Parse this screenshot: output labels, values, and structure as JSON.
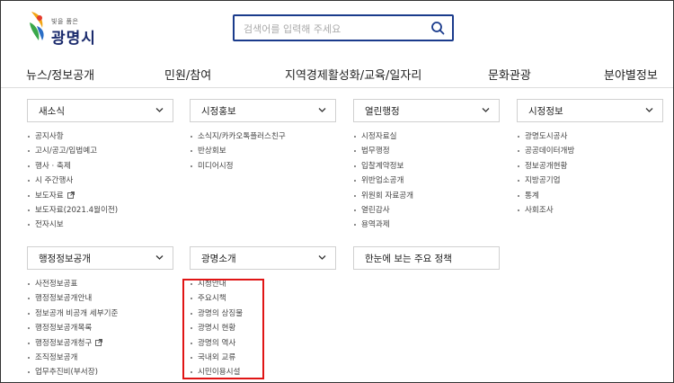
{
  "header": {
    "logo_slogan": "빛을 품은",
    "logo_name": "광명시",
    "search_placeholder": "검색어를 입력해 주세요"
  },
  "nav": [
    "뉴스/정보공개",
    "민원/참여",
    "지역경제활성화/교육/일자리",
    "문화관광",
    "분야별정보"
  ],
  "menus": {
    "news": {
      "title": "새소식",
      "items": [
        "공지사항",
        "고시/공고/입법예고",
        "행사 · 축제",
        "시 주간행사",
        "보도자료",
        "보도자료(2021.4월이전)",
        "전자시보"
      ]
    },
    "promo": {
      "title": "시정홍보",
      "items": [
        "소식지/카카오톡플러스친구",
        "반상회보",
        "미디어시정"
      ]
    },
    "open_admin": {
      "title": "열린행정",
      "items": [
        "시정자료실",
        "법무행정",
        "입찰계약정보",
        "위반업소공개",
        "위원회 자료공개",
        "열린감사",
        "용역과제"
      ]
    },
    "city_info": {
      "title": "시정정보",
      "items": [
        "광명도시공사",
        "공공데이터개방",
        "정보공개현황",
        "지방공기업",
        "통계",
        "사회조사"
      ]
    },
    "info_disclosure": {
      "title": "행정정보공개",
      "items": [
        "사전정보공표",
        "행정정보공개안내",
        "정보공개 비공개 세부기준",
        "행정정보공개목록",
        "행정정보공개청구",
        "조직정보공개",
        "업무추진비(부서장)"
      ]
    },
    "intro": {
      "title": "광명소개",
      "items": [
        "시청안내",
        "주요시책",
        "광명의 상징물",
        "광명시 현황",
        "광명의 역사",
        "국내외 교류",
        "시민이용시설"
      ]
    },
    "policy": {
      "title": "한눈에 보는 주요 정책"
    }
  },
  "colors": {
    "brand_navy": "#1a3b8c",
    "highlight_red": "#e01515"
  }
}
